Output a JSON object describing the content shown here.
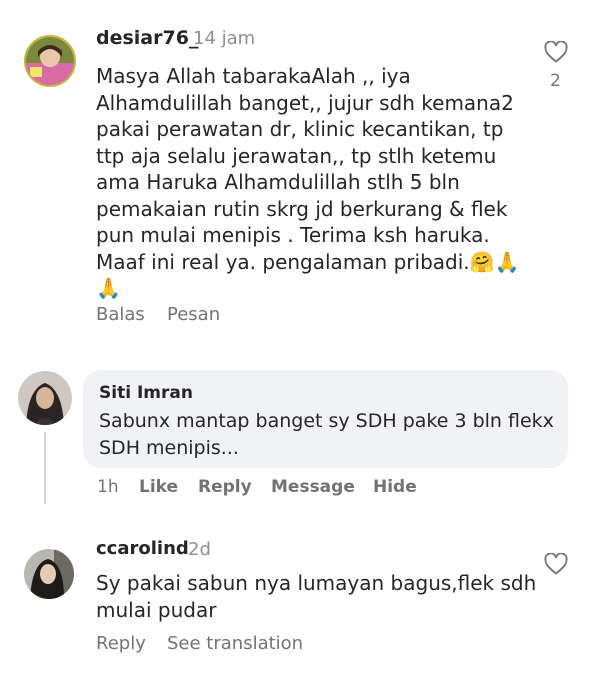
{
  "comments": [
    {
      "username": "desiar76_",
      "time": "14 jam",
      "text_lines": [
        "Masya Allah tabarakaAlah ,, iya",
        "Alhamdulillah banget,, jujur sdh kemana2",
        "pakai perawatan dr, klinic kecantikan,  tp",
        "ttp aja selalu jerawatan,, tp stlh ketemu",
        "ama Haruka Alhamdulillah stlh 5 bln",
        "pemakaian rutin skrg jd berkurang & flek",
        "pun mulai menipis . Terima ksh haruka.",
        "Maaf ini real ya. pengalaman pribadi.🤗🙏",
        "🙏"
      ],
      "like_count": "2",
      "actions": {
        "reply": "Balas",
        "message": "Pesan"
      }
    },
    {
      "username": "Siti Imran",
      "text_lines": [
        "Sabunx mantap banget sy SDH pake 3 bln flekx",
        "SDH menipis..."
      ],
      "actions": {
        "time": "1h",
        "like": "Like",
        "reply": "Reply",
        "message": "Message",
        "hide": "Hide"
      }
    },
    {
      "username": "ccarolind",
      "time": "2d",
      "text_lines": [
        "Sy pakai sabun nya lumayan bagus,flek sdh",
        "mulai pudar"
      ],
      "actions": {
        "reply": "Reply",
        "see_translation": "See translation"
      }
    }
  ],
  "colors": {
    "text": "#262626",
    "secondary": "#737373",
    "bubble": "#f0f2f5"
  },
  "icons": [
    "heart-outline-icon"
  ]
}
